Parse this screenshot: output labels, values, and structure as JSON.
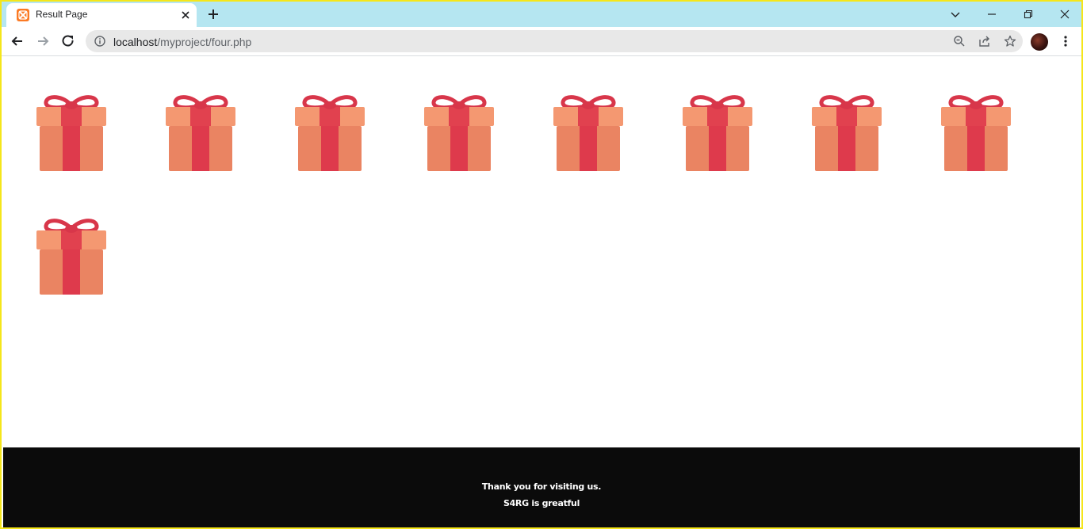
{
  "browser": {
    "tab": {
      "title": "Result Page",
      "favicon": "xampp-icon"
    },
    "url": {
      "host": "localhost",
      "path": "/myproject/four.php"
    }
  },
  "page": {
    "gift_count": 9,
    "gift_colors": {
      "box": "#ea8462",
      "lid": "#f49871",
      "ribbon": "#de3a4c",
      "bow": "#d8364a"
    }
  },
  "footer": {
    "line1": "Thank you for visiting us.",
    "line2": "S4RG is greatful"
  },
  "colors": {
    "tabstrip": "#b5e6f1",
    "frame": "#f5e61a",
    "footer_bg": "#0b0b0b"
  }
}
